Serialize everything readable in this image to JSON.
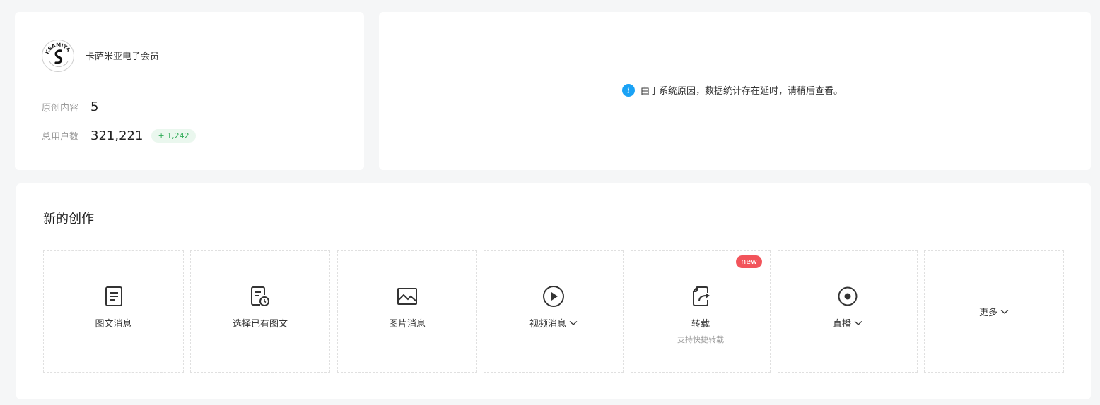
{
  "account": {
    "name": "卡萨米亚电子会员",
    "logo_text": "KSAMIYA",
    "stats": [
      {
        "label": "原创内容",
        "value": "5"
      },
      {
        "label": "总用户数",
        "value": "321,221",
        "growth": "+ 1,242"
      }
    ]
  },
  "notice": {
    "icon": "info-icon",
    "text": "由于系统原因，数据统计存在延时，请稍后查看。"
  },
  "create": {
    "title": "新的创作",
    "tiles": [
      {
        "label": "图文消息",
        "icon": "article-icon"
      },
      {
        "label": "选择已有图文",
        "icon": "article-history-icon"
      },
      {
        "label": "图片消息",
        "icon": "image-icon"
      },
      {
        "label": "视频消息",
        "icon": "play-icon",
        "has_dropdown": true
      },
      {
        "label": "转载",
        "icon": "repost-icon",
        "subtitle": "支持快捷转载",
        "badge": "new"
      },
      {
        "label": "直播",
        "icon": "live-icon",
        "has_dropdown": true
      },
      {
        "label": "更多",
        "has_dropdown": true
      }
    ]
  },
  "colors": {
    "info": "#1aa2f5",
    "badge": "#f2545b",
    "growth_text": "#2eaa55",
    "growth_bg": "#eaf7ee"
  }
}
